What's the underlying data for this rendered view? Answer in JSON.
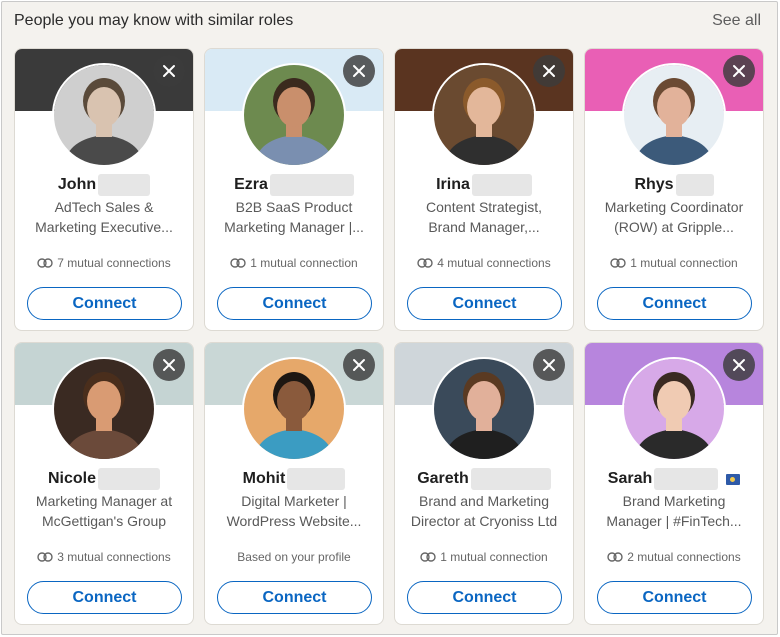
{
  "header": {
    "title": "People you may know with similar roles",
    "see_all": "See all"
  },
  "cards": [
    {
      "name": "John",
      "headline": [
        "AdTech Sales &",
        "Marketing Executive..."
      ],
      "mutual": "7 mutual connections",
      "connect": "Connect",
      "banner": "#3a3a3a",
      "avatar_bg": "#cfcfcf",
      "skin": "#d9c3b0",
      "hair": "#5a4a3a",
      "shirt": "#4a4a4a"
    },
    {
      "name": "Ezra",
      "headline": [
        "B2B SaaS Product",
        "Marketing Manager |..."
      ],
      "mutual": "1 mutual connection",
      "connect": "Connect",
      "banner": "#d9eaf5",
      "avatar_bg": "#6d8a4f",
      "skin": "#c98f6c",
      "hair": "#3b2a1e",
      "shirt": "#7a8fb0"
    },
    {
      "name": "Irina",
      "headline": [
        "Content Strategist,",
        "Brand Manager,..."
      ],
      "mutual": "4 mutual connections",
      "connect": "Connect",
      "banner": "#5a3420",
      "avatar_bg": "#6a4a30",
      "skin": "#e3b79a",
      "hair": "#8b5a2b",
      "shirt": "#2f2f2f"
    },
    {
      "name": "Rhys",
      "headline": [
        "Marketing Coordinator",
        "(ROW) at Gripple..."
      ],
      "mutual": "1 mutual connection",
      "connect": "Connect",
      "banner": "#e95fb5",
      "avatar_bg": "#e7eef3",
      "skin": "#e2b29a",
      "hair": "#6b4a33",
      "shirt": "#3c5a7a"
    },
    {
      "name": "Nicole",
      "headline": [
        "Marketing Manager at",
        "McGettigan's Group"
      ],
      "mutual": "3 mutual connections",
      "connect": "Connect",
      "banner": "#c5d4d3",
      "avatar_bg": "#3a2a22",
      "skin": "#d99b73",
      "hair": "#4a2e1c",
      "shirt": "#6b4a3a"
    },
    {
      "name": "Mohit",
      "headline": [
        "Digital Marketer |",
        "WordPress Website..."
      ],
      "mutual": "Based on your profile",
      "connect": "Connect",
      "banner": "#c9d7d6",
      "avatar_bg": "#e6a86a",
      "skin": "#8a5a3c",
      "hair": "#1e1712",
      "shirt": "#3b9cc2"
    },
    {
      "name": "Gareth",
      "headline": [
        "Brand and Marketing",
        "Director at Cryoniss Ltd"
      ],
      "mutual": "1 mutual connection",
      "connect": "Connect",
      "banner": "#cfd6da",
      "avatar_bg": "#3a4a5a",
      "skin": "#e1b09a",
      "hair": "#5a3a22",
      "shirt": "#1f1f1f"
    },
    {
      "name": "Sarah",
      "headline": [
        "Brand Marketing",
        "Manager | #FinTech..."
      ],
      "mutual": "2 mutual connections",
      "connect": "Connect",
      "banner": "#b785dd",
      "avatar_bg": "#d7a9e8",
      "skin": "#f0cbb3",
      "hair": "#3a2a22",
      "shirt": "#2a2a2a"
    }
  ]
}
